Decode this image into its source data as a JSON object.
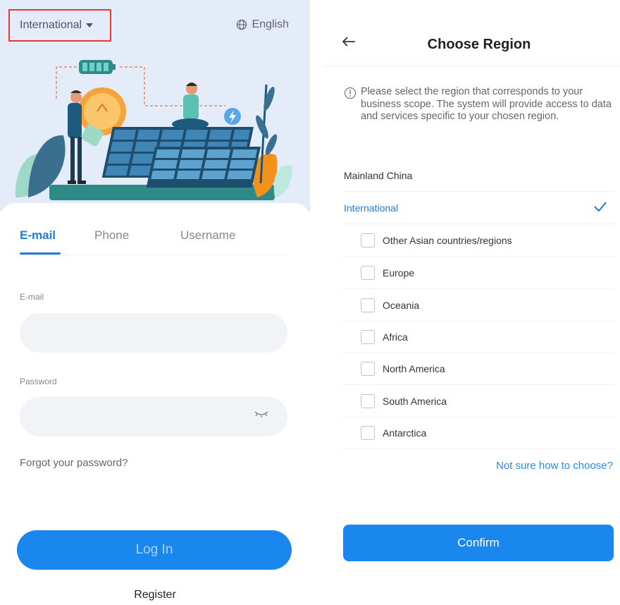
{
  "login": {
    "region_selector": "International",
    "language": "English",
    "tabs": [
      {
        "label": "E-mail",
        "active": true
      },
      {
        "label": "Phone",
        "active": false
      },
      {
        "label": "Username",
        "active": false
      }
    ],
    "email_label": "E-mail",
    "email_value": "",
    "password_label": "Password",
    "password_value": "",
    "forgot_password": "Forgot your password?",
    "login_button": "Log In",
    "register_link": "Register"
  },
  "region": {
    "title": "Choose Region",
    "notice": "Please select the region that corresponds to your business scope. The system will provide access to data and services specific to your chosen region.",
    "options": [
      {
        "label": "Mainland China",
        "selected": false
      },
      {
        "label": "International",
        "selected": true
      }
    ],
    "sub_regions": [
      {
        "label": "Other Asian countries/regions",
        "checked": false
      },
      {
        "label": "Europe",
        "checked": false
      },
      {
        "label": "Oceania",
        "checked": false
      },
      {
        "label": "Africa",
        "checked": false
      },
      {
        "label": "North America",
        "checked": false
      },
      {
        "label": "South America",
        "checked": false
      },
      {
        "label": "Antarctica",
        "checked": false
      }
    ],
    "help_link": "Not sure how to choose?",
    "confirm_button": "Confirm"
  },
  "colors": {
    "accent": "#1e7be0",
    "button": "#1a87ee",
    "highlight_border": "#e53935",
    "hero_background": "#e4ebf9"
  },
  "icons": [
    "caret-down-icon",
    "globe-icon",
    "eye-closed-icon",
    "back-arrow-icon",
    "info-icon",
    "checkmark-icon",
    "checkbox-icon"
  ]
}
